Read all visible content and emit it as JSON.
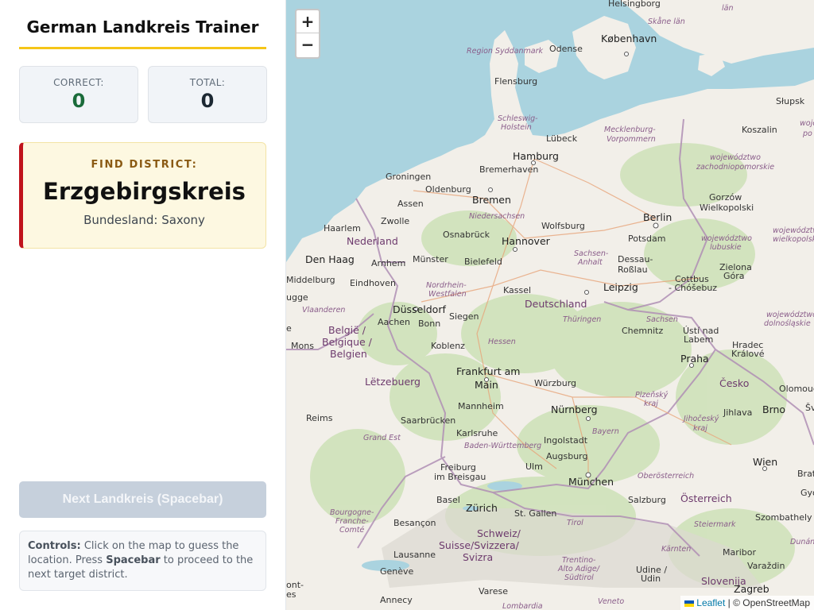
{
  "app": {
    "title": "German Landkreis Trainer"
  },
  "stats": {
    "correct_label": "CORRECT:",
    "correct_value": "0",
    "total_label": "TOTAL:",
    "total_value": "0"
  },
  "target": {
    "label": "FIND DISTRICT:",
    "name": "Erzgebirgskreis",
    "state": "Bundesland: Saxony"
  },
  "actions": {
    "next_label": "Next Landkreis (Spacebar)"
  },
  "controls": {
    "heading": "Controls:",
    "text_1": "Click on the map to guess the location. Press",
    "key": "Spacebar",
    "text_2": "to proceed to the next target district."
  },
  "map": {
    "zoom_in": "+",
    "zoom_out": "−",
    "attribution_link": "Leaflet",
    "attribution_sep": "|",
    "attribution_text": "© OpenStreetMap",
    "labels": {
      "helsingborg": "Helsingborg",
      "skane": "Skåne län",
      "lan": "län",
      "kobenhavn": "København",
      "syddanmark": "Region Syddanmark",
      "odense": "Odense",
      "flensburg": "Flensburg",
      "slupsk": "Słupsk",
      "schleswig": "Schleswig-",
      "holstein": "Holstein",
      "lubeck": "Lübeck",
      "mecklenburg": "Mecklenburg-",
      "vorpommern": "Vorpommern",
      "koszalin": "Koszalin",
      "woj_r": "woje",
      "po_r": "po",
      "hamburg": "Hamburg",
      "woj_zach1": "województwo",
      "woj_zach2": "zachodniopomorskie",
      "groningen": "Groningen",
      "bremerhaven": "Bremerhaven",
      "oldenburg": "Oldenburg",
      "bremen": "Bremen",
      "assen": "Assen",
      "gorzow": "Gorzów",
      "wielkopolski": "Wielkopolski",
      "niedersachsen": "Niedersachsen",
      "zwolle": "Zwolle",
      "wolfsburg": "Wolfsburg",
      "berlin": "Berlin",
      "woj_wlkp1": "województwo",
      "woj_wlkp2": "wielkopolskie",
      "haarlem": "Haarlem",
      "osnabruck": "Osnabrück",
      "nederland": "Nederland",
      "hannover": "Hannover",
      "potsdam": "Potsdam",
      "woj_lub1": "województwo",
      "woj_lub2": "lubuskie",
      "denhaag": "Den Haag",
      "arnhem": "Arnhem",
      "munster": "Münster",
      "bielefeld": "Bielefeld",
      "sachsenanhalt1": "Sachsen-",
      "sachsenanhalt2": "Anhalt",
      "dessau": "Dessau-",
      "rosslau": "Roßlau",
      "zielona": "Zielona",
      "gora": "Góra",
      "middelburg": "Middelburg",
      "eindhoven": "Eindhoven",
      "nrw1": "Nordrhein-",
      "nrw2": "Westfalen",
      "kassel": "Kassel",
      "leipzig": "Leipzig",
      "cottbus": "Cottbus",
      "chosebuz": "- Chóšebuz",
      "brugge": "ugge",
      "dusseldorf": "Düsseldorf",
      "deutschland": "Deutschland",
      "vlaanderen": "Vlaanderen",
      "aachen": "Aachen",
      "siegen": "Siegen",
      "thuringen": "Thüringen",
      "sachsen": "Sachsen",
      "woj_dol1": "województwo",
      "woj_dol2": "dolnośląskie",
      "belgie1": "België /",
      "belgie2": "Belgique /",
      "belgie3": "Belgien",
      "bonn": "Bonn",
      "chemnitz": "Chemnitz",
      "usti1": "Ústí nad",
      "usti2": "Labem",
      "mons": "Mons",
      "koblenz": "Koblenz",
      "hessen": "Hessen",
      "hradec1": "Hradec",
      "hradec2": "Králové",
      "praha": "Praha",
      "frankfurt1": "Frankfurt am",
      "frankfurt2": "Main",
      "letzebuerg": "Lëtzebuerg",
      "wurzburg": "Würzburg",
      "cesko": "Česko",
      "olomouc": "Olomouc",
      "plzen1": "Plzeňský",
      "plzen2": "kraj",
      "reims": "Reims",
      "saarbrucken": "Saarbrücken",
      "mannheim": "Mannheim",
      "nurnberg": "Nürnberg",
      "jihlava": "Jihlava",
      "brno": "Brno",
      "jihocesky1": "Jihočeský",
      "jihocesky2": "kraj",
      "karlsruhe": "Karlsruhe",
      "bayern": "Bayern",
      "grandest": "Grand Est",
      "ingolstadt": "Ingolstadt",
      "bw": "Baden-Württemberg",
      "augsburg": "Augsburg",
      "ulm": "Ulm",
      "wien": "Wien",
      "bratislava": "Brat",
      "freiburg1": "Freiburg",
      "freiburg2": "im Breisgau",
      "oberosterreich": "Oberösterreich",
      "munchen": "München",
      "basel": "Basel",
      "salzburg": "Salzburg",
      "osterreich": "Österreich",
      "gyor": "Győ",
      "zurich": "Zürich",
      "stgallen": "St. Gallen",
      "bourgogne1": "Bourgogne-",
      "bourgogne2": "Franche-",
      "bourgogne3": "Comté",
      "besancon": "Besançon",
      "schweiz1": "Schweiz/",
      "schweiz2": "Suisse/Svizzera/",
      "schweiz3": "Svizra",
      "tirol": "Tirol",
      "steiermark": "Steiermark",
      "szombathely": "Szombathely",
      "lausanne": "Lausanne",
      "karnten": "Kärnten",
      "maribor": "Maribor",
      "dunan": "Dunán",
      "trentino1": "Trentino-",
      "trentino2": "Alto Adige/",
      "trentino3": "Südtirol",
      "geneve": "Genève",
      "udine1": "Udine /",
      "udine2": "Udin",
      "varazdin": "Varaždin",
      "slovenija": "Slovenija",
      "annecy": "Annecy",
      "varese": "Varese",
      "veneto": "Veneto",
      "zagreb": "Zagreb",
      "lombardia": "Lombardia",
      "ont": "ont-",
      "ont2": "es",
      "e_left": "e",
      "sve": "Šve"
    }
  }
}
